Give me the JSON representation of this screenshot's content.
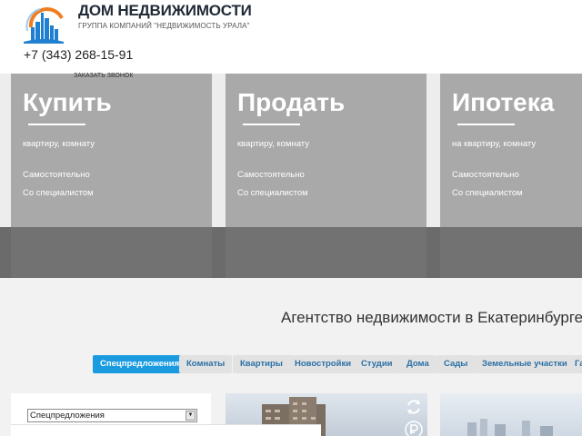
{
  "header": {
    "brand_name": "ДОМ НЕДВИЖИМОСТИ",
    "brand_sub": "ГРУППА КОМПАНИЙ \"НЕДВИЖИМОСТЬ УРАЛА\"",
    "phone": "+7 (343) 268-15-91",
    "callback_label": "ЗАКАЗАТЬ ЗВОНОК"
  },
  "cards": [
    {
      "title": "Купить",
      "subtitle": "квартиру, комнату",
      "link1": "Самостоятельно",
      "link2": "Со специалистом"
    },
    {
      "title": "Продать",
      "subtitle": "квартиру, комнату",
      "link1": "Самостоятельно",
      "link2": "Со специалистом"
    },
    {
      "title": "Ипотека",
      "subtitle": "на квартиру, комнату",
      "link1": "Самостоятельно",
      "link2": "Со специалистом"
    }
  ],
  "agency_title": "Агентство недвижимости в Екатеринбурге",
  "tabs": [
    "Спецпредложения",
    "Комнаты",
    "Квартиры",
    "Новостройки",
    "Студии",
    "Дома",
    "Сады",
    "Земельные участки",
    "Га"
  ],
  "filter": {
    "selected": "Спецпредложения"
  },
  "icons": {
    "logo": "city-logo-icon",
    "refresh": "refresh-icon",
    "ruble": "ruble-icon",
    "dropdown": "dropdown-arrow-icon"
  },
  "colors": {
    "accent": "#1a9be0",
    "tab_text": "#2b6fa5",
    "card_bg": "#a9a9a9",
    "logo_orange": "#f07d1e",
    "logo_blue": "#1f7fd0"
  }
}
